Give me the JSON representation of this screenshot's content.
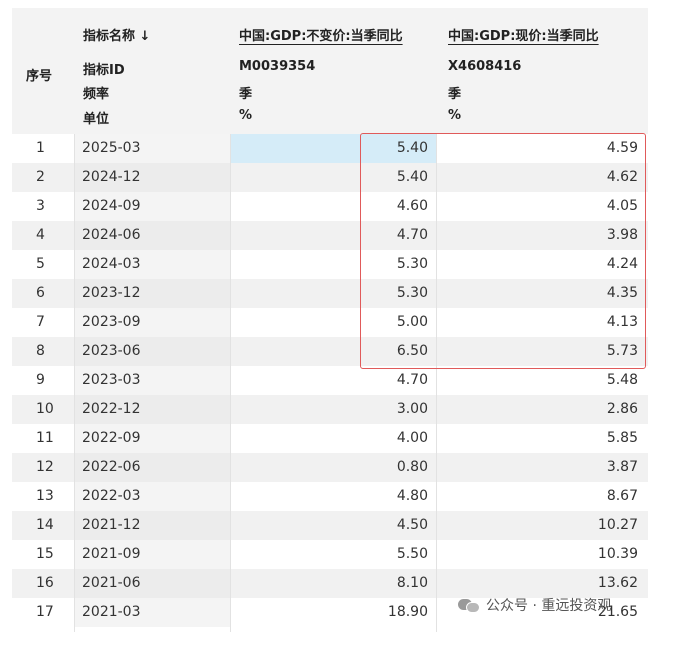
{
  "header": {
    "col_index": "序号",
    "col_name": "指标名称 ↓",
    "col_id": "指标ID",
    "col_freq": "频率",
    "col_unit": "单位",
    "series1": {
      "name": "中国:GDP:不变价:当季同比",
      "id": "M0039354",
      "freq": "季",
      "unit": "%"
    },
    "series2": {
      "name": "中国:GDP:现价:当季同比",
      "id": "X4608416",
      "freq": "季",
      "unit": "%"
    }
  },
  "rows": [
    {
      "idx": "1",
      "date": "2025-03",
      "v1": "5.40",
      "v2": "4.59"
    },
    {
      "idx": "2",
      "date": "2024-12",
      "v1": "5.40",
      "v2": "4.62"
    },
    {
      "idx": "3",
      "date": "2024-09",
      "v1": "4.60",
      "v2": "4.05"
    },
    {
      "idx": "4",
      "date": "2024-06",
      "v1": "4.70",
      "v2": "3.98"
    },
    {
      "idx": "5",
      "date": "2024-03",
      "v1": "5.30",
      "v2": "4.24"
    },
    {
      "idx": "6",
      "date": "2023-12",
      "v1": "5.30",
      "v2": "4.35"
    },
    {
      "idx": "7",
      "date": "2023-09",
      "v1": "5.00",
      "v2": "4.13"
    },
    {
      "idx": "8",
      "date": "2023-06",
      "v1": "6.50",
      "v2": "5.73"
    },
    {
      "idx": "9",
      "date": "2023-03",
      "v1": "4.70",
      "v2": "5.48"
    },
    {
      "idx": "10",
      "date": "2022-12",
      "v1": "3.00",
      "v2": "2.86"
    },
    {
      "idx": "11",
      "date": "2022-09",
      "v1": "4.00",
      "v2": "5.85"
    },
    {
      "idx": "12",
      "date": "2022-06",
      "v1": "0.80",
      "v2": "3.87"
    },
    {
      "idx": "13",
      "date": "2022-03",
      "v1": "4.80",
      "v2": "8.67"
    },
    {
      "idx": "14",
      "date": "2021-12",
      "v1": "4.50",
      "v2": "10.27"
    },
    {
      "idx": "15",
      "date": "2021-09",
      "v1": "5.50",
      "v2": "10.39"
    },
    {
      "idx": "16",
      "date": "2021-06",
      "v1": "8.10",
      "v2": "13.62"
    },
    {
      "idx": "17",
      "date": "2021-03",
      "v1": "18.90",
      "v2": "21.65"
    }
  ],
  "selected_row": 0,
  "watermark": "公众号 · 重远投资观",
  "colors": {
    "highlight_border": "#e05a5a",
    "selected_cell": "#d5ecf8",
    "header_bg": "#f3f3f3"
  }
}
